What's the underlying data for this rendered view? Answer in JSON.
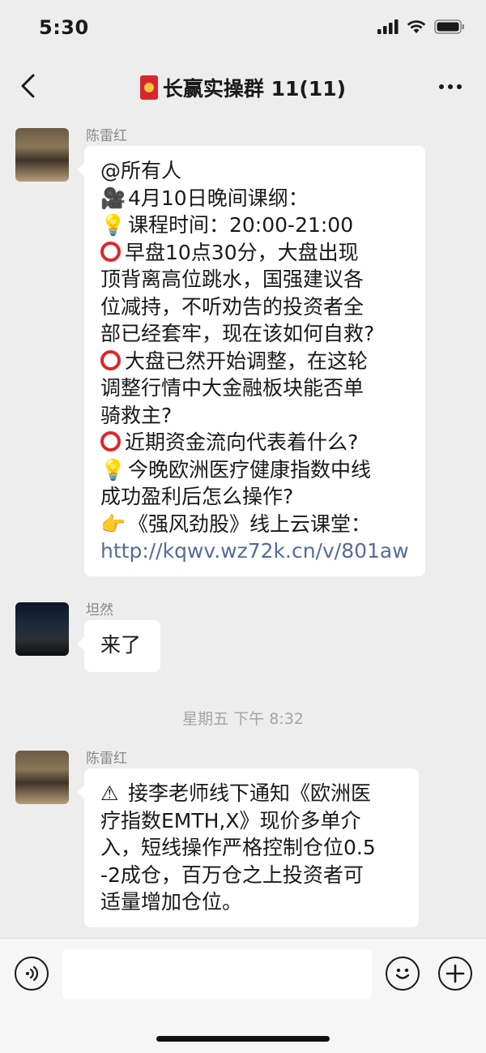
{
  "status_bar": {
    "time": "5:30"
  },
  "nav": {
    "title": "长赢实操群 11(11)",
    "title_icon": "red-envelope-icon"
  },
  "messages": [
    {
      "sender": "陈雷红",
      "lines": [
        {
          "icon": "",
          "text": "@所有人"
        },
        {
          "icon": "🎥",
          "text": "4月10日晚间课纲："
        },
        {
          "icon": "💡",
          "text": "课程时间：20:00-21:00"
        },
        {
          "icon": "ring",
          "text": "早盘10点30分，大盘出现"
        },
        {
          "icon": "",
          "text": "顶背离高位跳水，国强建议各"
        },
        {
          "icon": "",
          "text": "位减持，不听劝告的投资者全"
        },
        {
          "icon": "",
          "text": "部已经套牢，现在该如何自救?"
        },
        {
          "icon": "ring",
          "text": "大盘已然开始调整，在这轮"
        },
        {
          "icon": "",
          "text": "调整行情中大金融板块能否单"
        },
        {
          "icon": "",
          "text": "骑救主?"
        },
        {
          "icon": "ring",
          "text": "近期资金流向代表着什么?"
        },
        {
          "icon": "💡",
          "text": "今晚欧洲医疗健康指数中线"
        },
        {
          "icon": "",
          "text": "成功盈利后怎么操作?"
        },
        {
          "icon": "👉",
          "text": "《强风劲股》线上云课堂："
        },
        {
          "icon": "",
          "text": "http://kqwv.wz72k.cn/v/801aw",
          "link": true
        }
      ]
    },
    {
      "sender": "坦然",
      "lines": [
        {
          "icon": "",
          "text": "来了"
        }
      ]
    },
    {
      "sender": "陈雷红",
      "lines": [
        {
          "icon": "⚠",
          "text": "接李老师线下通知《欧洲医"
        },
        {
          "icon": "",
          "text": "疗指数EMTH,X》现价多单介"
        },
        {
          "icon": "",
          "text": "入，短线操作严格控制仓位0.5"
        },
        {
          "icon": "",
          "text": "-2成仓，百万仓之上投资者可"
        },
        {
          "icon": "",
          "text": "适量增加仓位。"
        }
      ]
    }
  ],
  "timestamp": "星期五 下午 8:32"
}
